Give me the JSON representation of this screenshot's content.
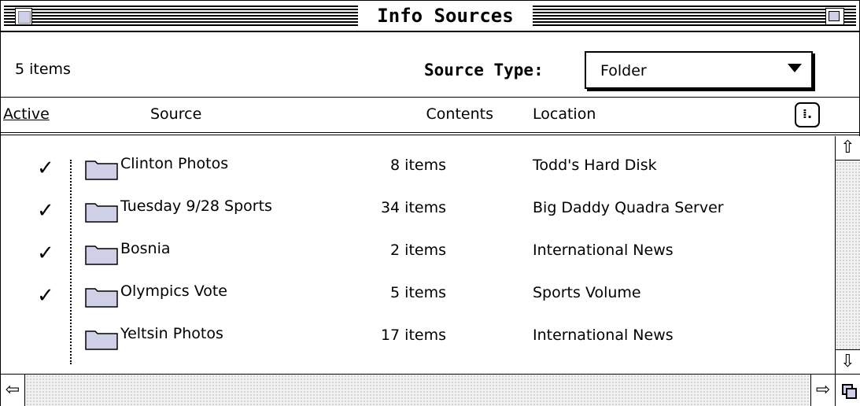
{
  "window": {
    "title": "Info Sources"
  },
  "info": {
    "item_count": "5 items",
    "source_type_label": "Source Type:",
    "source_type_value": "Folder"
  },
  "columns": {
    "active": "Active",
    "source": "Source",
    "contents": "Contents",
    "location": "Location"
  },
  "icons": {
    "view_toggle": "list-view-icon",
    "folder": "folder-icon",
    "check": "checkmark-icon"
  },
  "colors": {
    "folder_fill": "#cfcfe8"
  },
  "rows": [
    {
      "active": "✓",
      "source": "Clinton Photos",
      "contents": "8 items",
      "location": "Todd's Hard Disk"
    },
    {
      "active": "✓",
      "source": "Tuesday 9/28 Sports",
      "contents": "34 items",
      "location": "Big Daddy Quadra Server"
    },
    {
      "active": "✓",
      "source": "Bosnia",
      "contents": "2 items",
      "location": "International News"
    },
    {
      "active": "✓",
      "source": "Olympics Vote",
      "contents": "5 items",
      "location": "Sports Volume"
    },
    {
      "active": "",
      "source": "Yeltsin Photos",
      "contents": "17 items",
      "location": "International News"
    }
  ]
}
